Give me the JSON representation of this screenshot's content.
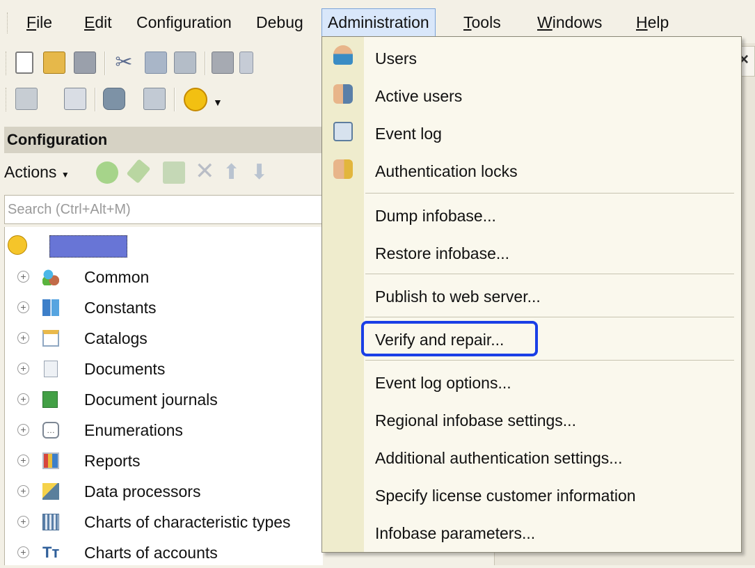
{
  "menubar": {
    "items": [
      {
        "label": "File",
        "mnemonic": "F",
        "rest": "ile"
      },
      {
        "label": "Edit",
        "mnemonic": "E",
        "rest": "dit"
      },
      {
        "label": "Configuration"
      },
      {
        "label": "Debug"
      },
      {
        "label": "Administration"
      },
      {
        "label": "Tools",
        "mnemonic": "T",
        "rest": "ools"
      },
      {
        "label": "Windows",
        "mnemonic": "W",
        "rest": "indows"
      },
      {
        "label": "Help",
        "mnemonic": "H",
        "rest": "elp"
      }
    ]
  },
  "config": {
    "header": "Configuration",
    "actions_label": "Actions",
    "search_placeholder": "Search (Ctrl+Alt+M)",
    "tree": [
      {
        "label": "Common",
        "icon": "common-icon"
      },
      {
        "label": "Constants",
        "icon": "constants-icon"
      },
      {
        "label": "Catalogs",
        "icon": "catalogs-icon"
      },
      {
        "label": "Documents",
        "icon": "documents-icon"
      },
      {
        "label": "Document journals",
        "icon": "document-journals-icon"
      },
      {
        "label": "Enumerations",
        "icon": "enumerations-icon"
      },
      {
        "label": "Reports",
        "icon": "reports-icon"
      },
      {
        "label": "Data processors",
        "icon": "data-processors-icon"
      },
      {
        "label": "Charts of characteristic types",
        "icon": "charts-of-characteristic-types-icon"
      },
      {
        "label": "Charts of accounts",
        "icon": "charts-of-accounts-icon"
      }
    ]
  },
  "dropdown": {
    "items": [
      {
        "label": "Users",
        "icon": "users-icon"
      },
      {
        "label": "Active users",
        "icon": "active-users-icon"
      },
      {
        "label": "Event log",
        "icon": "event-log-icon"
      },
      {
        "label": "Authentication locks",
        "icon": "authentication-locks-icon"
      },
      {
        "label": "Dump infobase..."
      },
      {
        "label": "Restore infobase..."
      },
      {
        "label": "Publish to web server..."
      },
      {
        "label": "Verify and repair..."
      },
      {
        "label": "Event log options..."
      },
      {
        "label": "Regional infobase settings..."
      },
      {
        "label": "Additional authentication settings..."
      },
      {
        "label": "Specify license customer information"
      },
      {
        "label": "Infobase parameters..."
      }
    ]
  },
  "colors": {
    "highlight": "#1a3fe6",
    "menu_open": "#d9e7fa"
  }
}
